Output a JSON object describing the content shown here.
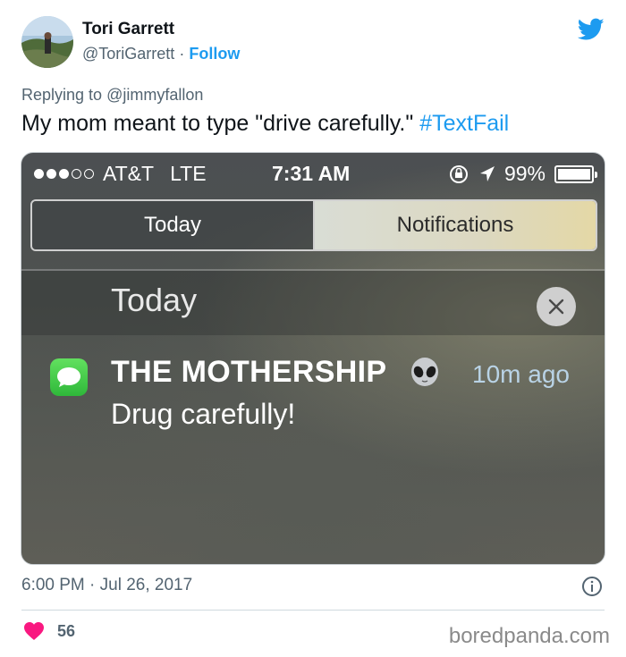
{
  "author": {
    "name": "Tori Garrett",
    "handle": "@ToriGarrett",
    "separator": "·",
    "follow_label": "Follow"
  },
  "reply": {
    "prefix": "Replying to",
    "mention": "@jimmyfallon"
  },
  "tweet": {
    "text": "My mom meant to type \"drive carefully.\" ",
    "hashtag": "#TextFail"
  },
  "screenshot": {
    "status": {
      "carrier": "AT&T",
      "network": "LTE",
      "time": "7:31 AM",
      "battery": "99%",
      "battery_level": 0.99
    },
    "tabs": [
      "Today",
      "Notifications"
    ],
    "section_title": "Today",
    "notification": {
      "sender": "THE MOTHERSHIP",
      "time_ago": "10m ago",
      "message": "Drug carefully!"
    }
  },
  "meta": {
    "timestamp": "6:00 PM · Jul 26, 2017"
  },
  "likes": {
    "count": "56"
  },
  "watermark": "boredpanda.com",
  "colors": {
    "twitter_blue": "#1d9bf0",
    "heart_red": "#f91880",
    "text_gray": "#536471"
  }
}
